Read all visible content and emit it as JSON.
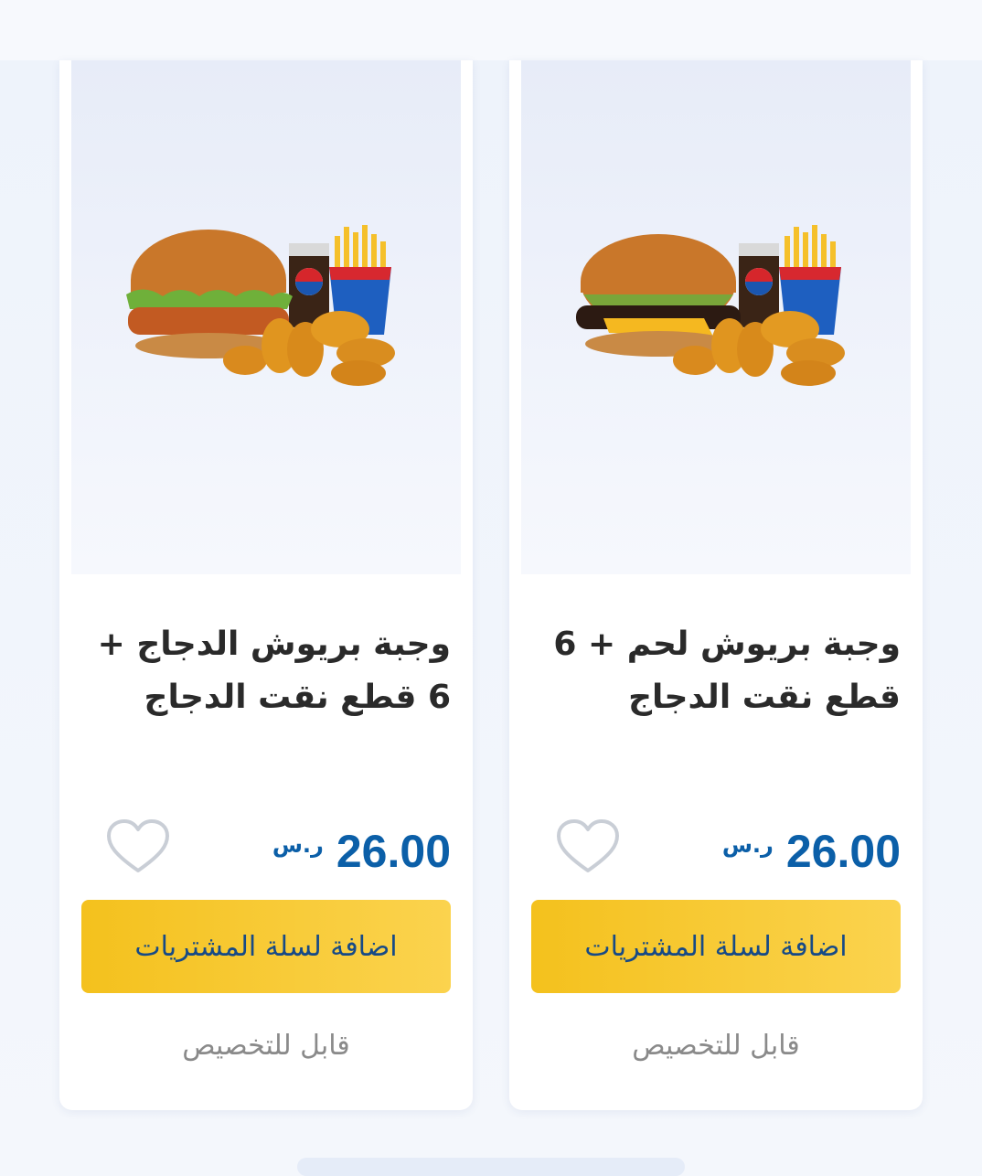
{
  "products": [
    {
      "title_line1": "وجبة بريوش لحم + 6",
      "title_line2": "قطع نقت الدجاج",
      "price": "26.00",
      "currency": "ر.س",
      "add_to_cart_label": "اضافة لسلة المشتريات",
      "customizable_label": "قابل للتخصيص",
      "image_icon": "beef-brioche-meal-image"
    },
    {
      "title_line1": "وجبة بريوش الدجاج +",
      "title_line2": "6 قطع نقت الدجاج",
      "price": "26.00",
      "currency": "ر.س",
      "add_to_cart_label": "اضافة لسلة المشتريات",
      "customizable_label": "قابل للتخصيص",
      "image_icon": "chicken-brioche-meal-image"
    }
  ],
  "colors": {
    "price": "#0b5fa8",
    "button": "#f4c11d",
    "button_text": "#174a86"
  }
}
